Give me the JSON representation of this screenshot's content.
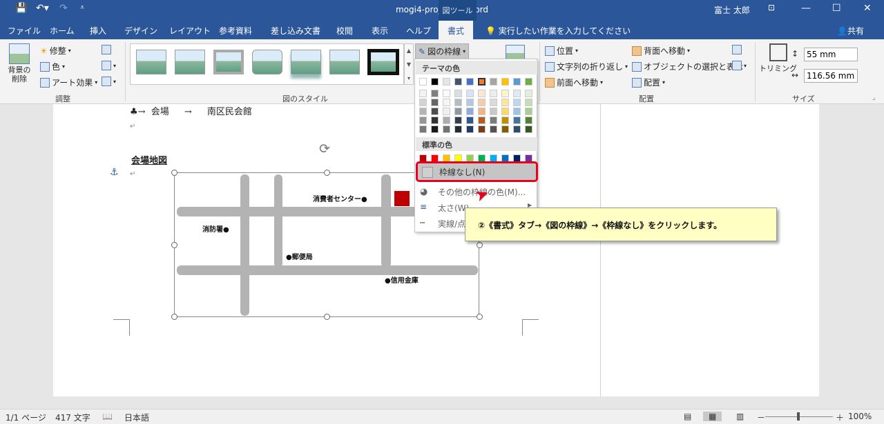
{
  "titlebar": {
    "title": "mogi4-project2  -  Word",
    "context_group": "図ツール",
    "user": "富士 太郎"
  },
  "tabs": [
    "ファイル",
    "ホーム",
    "挿入",
    "デザイン",
    "レイアウト",
    "参考資料",
    "差し込み文書",
    "校閲",
    "表示",
    "ヘルプ",
    "書式"
  ],
  "tellme": "実行したい作業を入力してください",
  "share": "共有",
  "ribbon": {
    "adjust": {
      "remove_bg": "背景の削除",
      "corrections": "修整",
      "color": "色",
      "artistic": "アート効果",
      "label": "調整"
    },
    "styles": {
      "label": "図のスタイル",
      "border_btn": "図の枠線"
    },
    "arrange": {
      "position": "位置",
      "wrap": "文字列の折り返し",
      "forward": "前面へ移動",
      "backward": "背面へ移動",
      "selection": "オブジェクトの選択と表示",
      "align": "配置",
      "label": "配置"
    },
    "size": {
      "crop": "トリミング",
      "height": "55 mm",
      "width": "116.56 mm",
      "label": "サイズ"
    }
  },
  "dropdown": {
    "theme_header": "テーマの色",
    "standard_header": "標準の色",
    "no_outline": "枠線なし(N)",
    "more_colors": "その他の枠線の色(M)...",
    "weight": "太さ(W)",
    "dashes": "実線/点"
  },
  "document": {
    "line1_sym": "♣→",
    "line1_label": "会場",
    "line1_arrow": "→",
    "line1_value": "南区民会館",
    "heading": "会場地図"
  },
  "map": {
    "consumer": "消費者センター●",
    "fire": "消防署●",
    "post": "●郵便局",
    "bank": "●信用金庫"
  },
  "callout": "②《書式》タブ→《図の枠線》→《枠線なし》をクリックします。",
  "status": {
    "page": "1/1 ページ",
    "words": "417 文字",
    "lang": "日本語",
    "zoom": "100%"
  },
  "colors": {
    "theme_top": [
      "#ffffff",
      "#000000",
      "#e7e6e6",
      "#44546a",
      "#4472c4",
      "#ed7d31",
      "#a5a5a5",
      "#ffc000",
      "#5b9bd5",
      "#70ad47"
    ],
    "standard": [
      "#c00000",
      "#ff0000",
      "#ffc000",
      "#ffff00",
      "#92d050",
      "#00b050",
      "#00b0f0",
      "#0070c0",
      "#002060",
      "#7030a0"
    ]
  }
}
